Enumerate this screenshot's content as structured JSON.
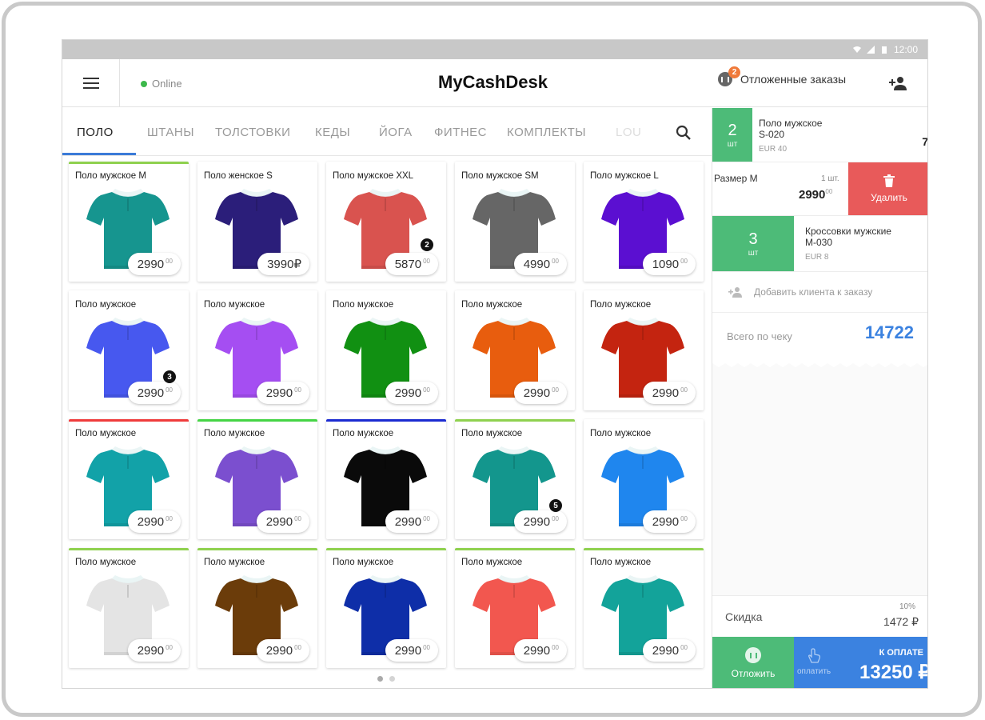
{
  "app": {
    "title": "MyCashDesk",
    "status": "Online",
    "clock": "12:00"
  },
  "header": {
    "deferred_label": "Отложенные заказы",
    "deferred_count": "2"
  },
  "tabs": [
    "ПОЛО",
    "ШТАНЫ",
    "ТОЛСТОВКИ",
    "КЕДЫ",
    "ЙОГА",
    "ФИТНЕС",
    "КОМПЛЕКТЫ",
    "LOU"
  ],
  "products": [
    {
      "name": "Поло мужское M",
      "price": "2990",
      "cents": "00",
      "color": "#16958f",
      "line": "#8fd14f",
      "qty": ""
    },
    {
      "name": "Поло женское S",
      "price": "3990₽",
      "cents": "",
      "color": "#2b1e7a",
      "line": "",
      "qty": ""
    },
    {
      "name": "Поло мужское XXL",
      "price": "5870",
      "cents": "00",
      "color": "#d9534f",
      "line": "",
      "qty": "2"
    },
    {
      "name": "Поло мужское SM",
      "price": "4990",
      "cents": "00",
      "color": "#666666",
      "line": "",
      "qty": ""
    },
    {
      "name": "Поло мужское L",
      "price": "1090",
      "cents": "00",
      "color": "#5b0fd1",
      "line": "",
      "qty": ""
    },
    {
      "name": "Поло мужское",
      "price": "2990",
      "cents": "00",
      "color": "#4758ef",
      "line": "",
      "qty": "3"
    },
    {
      "name": "Поло мужское",
      "price": "2990",
      "cents": "00",
      "color": "#a54ef2",
      "line": "",
      "qty": ""
    },
    {
      "name": "Поло мужское",
      "price": "2990",
      "cents": "00",
      "color": "#119012",
      "line": "",
      "qty": ""
    },
    {
      "name": "Поло мужское",
      "price": "2990",
      "cents": "00",
      "color": "#e85d0e",
      "line": "",
      "qty": ""
    },
    {
      "name": "Поло мужское",
      "price": "2990",
      "cents": "00",
      "color": "#c42410",
      "line": "",
      "qty": ""
    },
    {
      "name": "Поло мужское",
      "price": "2990",
      "cents": "00",
      "color": "#12a2a8",
      "line": "#ef3b3b",
      "qty": ""
    },
    {
      "name": "Поло мужское",
      "price": "2990",
      "cents": "00",
      "color": "#7b4fcf",
      "line": "#45d445",
      "qty": ""
    },
    {
      "name": "Поло мужское",
      "price": "2990",
      "cents": "00",
      "color": "#0a0a0a",
      "line": "#1c2bd1",
      "qty": ""
    },
    {
      "name": "Поло мужское",
      "price": "2990",
      "cents": "00",
      "color": "#13968d",
      "line": "#8fd14f",
      "qty": "5"
    },
    {
      "name": "Поло мужское",
      "price": "2990",
      "cents": "00",
      "color": "#1f86ee",
      "line": "",
      "qty": ""
    },
    {
      "name": "Поло мужское",
      "price": "2990",
      "cents": "00",
      "color": "#e4e4e4",
      "line": "#8fd14f",
      "qty": ""
    },
    {
      "name": "Поло мужское",
      "price": "2990",
      "cents": "00",
      "color": "#6b3c0a",
      "line": "#8fd14f",
      "qty": ""
    },
    {
      "name": "Поло мужское",
      "price": "2990",
      "cents": "00",
      "color": "#0e2ea8",
      "line": "#8fd14f",
      "qty": ""
    },
    {
      "name": "Поло мужское",
      "price": "2990",
      "cents": "00",
      "color": "#f2574f",
      "line": "#8fd14f",
      "qty": ""
    },
    {
      "name": "Поло мужское",
      "price": "2990",
      "cents": "00",
      "color": "#13a39a",
      "line": "#8fd14f",
      "qty": ""
    }
  ],
  "cart": {
    "items": [
      {
        "qty": "2",
        "unit": "шт",
        "name": "Поло мужское",
        "sku": "S-020",
        "currency": "EUR 40",
        "amount": "7"
      },
      {
        "size": "Размер M",
        "qty_label": "1 шт.",
        "price": "2990",
        "cents": "00",
        "delete_label": "Удалить"
      },
      {
        "qty": "3",
        "unit": "шт",
        "name": "Кроссовки мужские",
        "sku": "M-030",
        "currency": "EUR 8"
      }
    ],
    "add_client": "Добавить клиента к заказу",
    "total_label": "Всего по чеку",
    "total": "14722",
    "discount_label": "Скидка",
    "discount_pct": "10%",
    "discount_amount": "1472 ₽",
    "defer_label": "Отложить",
    "pay_hint": "оплатить",
    "pay_label": "К ОПЛАТЕ",
    "pay_amount": "13250 ₽"
  }
}
